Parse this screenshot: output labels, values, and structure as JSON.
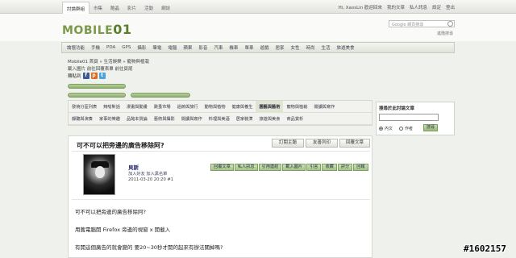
{
  "topbar": {
    "tabs": [
      "討論群組",
      "市集",
      "酷晶",
      "影片",
      "活動",
      "網誌"
    ],
    "greeting": "Hi, XaosLin 歡迎回來",
    "user_links": [
      "我的文章",
      "私人訊息",
      "設定",
      "登出"
    ]
  },
  "header": {
    "logo_text": "MOBILE",
    "logo_mark": "01",
    "search_placeholder": "Google 網頁搜尋",
    "advanced_search": "進階搜尋"
  },
  "catnav": [
    "論壇功能",
    "手機",
    "PDA",
    "GPS",
    "攝影",
    "筆電",
    "電腦",
    "蘋果",
    "影音",
    "汽車",
    "機車",
    "單車",
    "遊戲",
    "居家",
    "女性",
    "時尚",
    "生活",
    "旅遊美食"
  ],
  "breadcrumb": {
    "line1": "Mobile01 首頁 » 生活娛樂 » 寵物與植栽",
    "line2": "載入圖片  前往回覆表單  前往頁尾",
    "share_label": "轉貼到"
  },
  "forum_rows": [
    [
      "發燒分區列表",
      "夠嗆對話",
      "漫畫與動畫",
      "跳蚤市場",
      "過節與旅行",
      "動物與植物",
      "健康與養生",
      "園藝與藝術",
      "寵物與植栽",
      "閱讀與寫作"
    ],
    [
      "靜聽與演奏",
      "家事的樂趣",
      "品酩本質論",
      "藝術與攝影",
      "閱讀與寫作",
      "料理與美酒",
      "居家裝潢",
      "旅遊與美食",
      "商品賞析"
    ]
  ],
  "forum_selected": "寵物與植栽",
  "sidebox": {
    "title": "搜尋於此討論文章",
    "options": [
      "內文",
      "作者"
    ],
    "button": "搜尋"
  },
  "post": {
    "title": "可不可以把旁邊的廣告移除阿?",
    "actions": [
      "訂閱主題",
      "友善列印",
      "回覆文章"
    ],
    "author": "貝斯",
    "author_links": "加入好友  加入黑名單",
    "datetime": "2011-03-20 20:20  #1",
    "tools": [
      "回覆文章",
      "私人訊息",
      "引用連結",
      "載入圖片",
      "引言",
      "收藏",
      "評分",
      "回報"
    ],
    "lines": [
      "可不可以把旁邊的廣告移除阿?",
      "用舊電腦開 Firefox 旁邊的視窗 x 開載入",
      "有開這個廣告的就會變的  要20~30秒才開的起來有辦法關掉嗎?"
    ]
  },
  "watermark": "#1602157",
  "colors": {
    "accent": "#7a9a4a",
    "button_green": "#a6c487"
  }
}
